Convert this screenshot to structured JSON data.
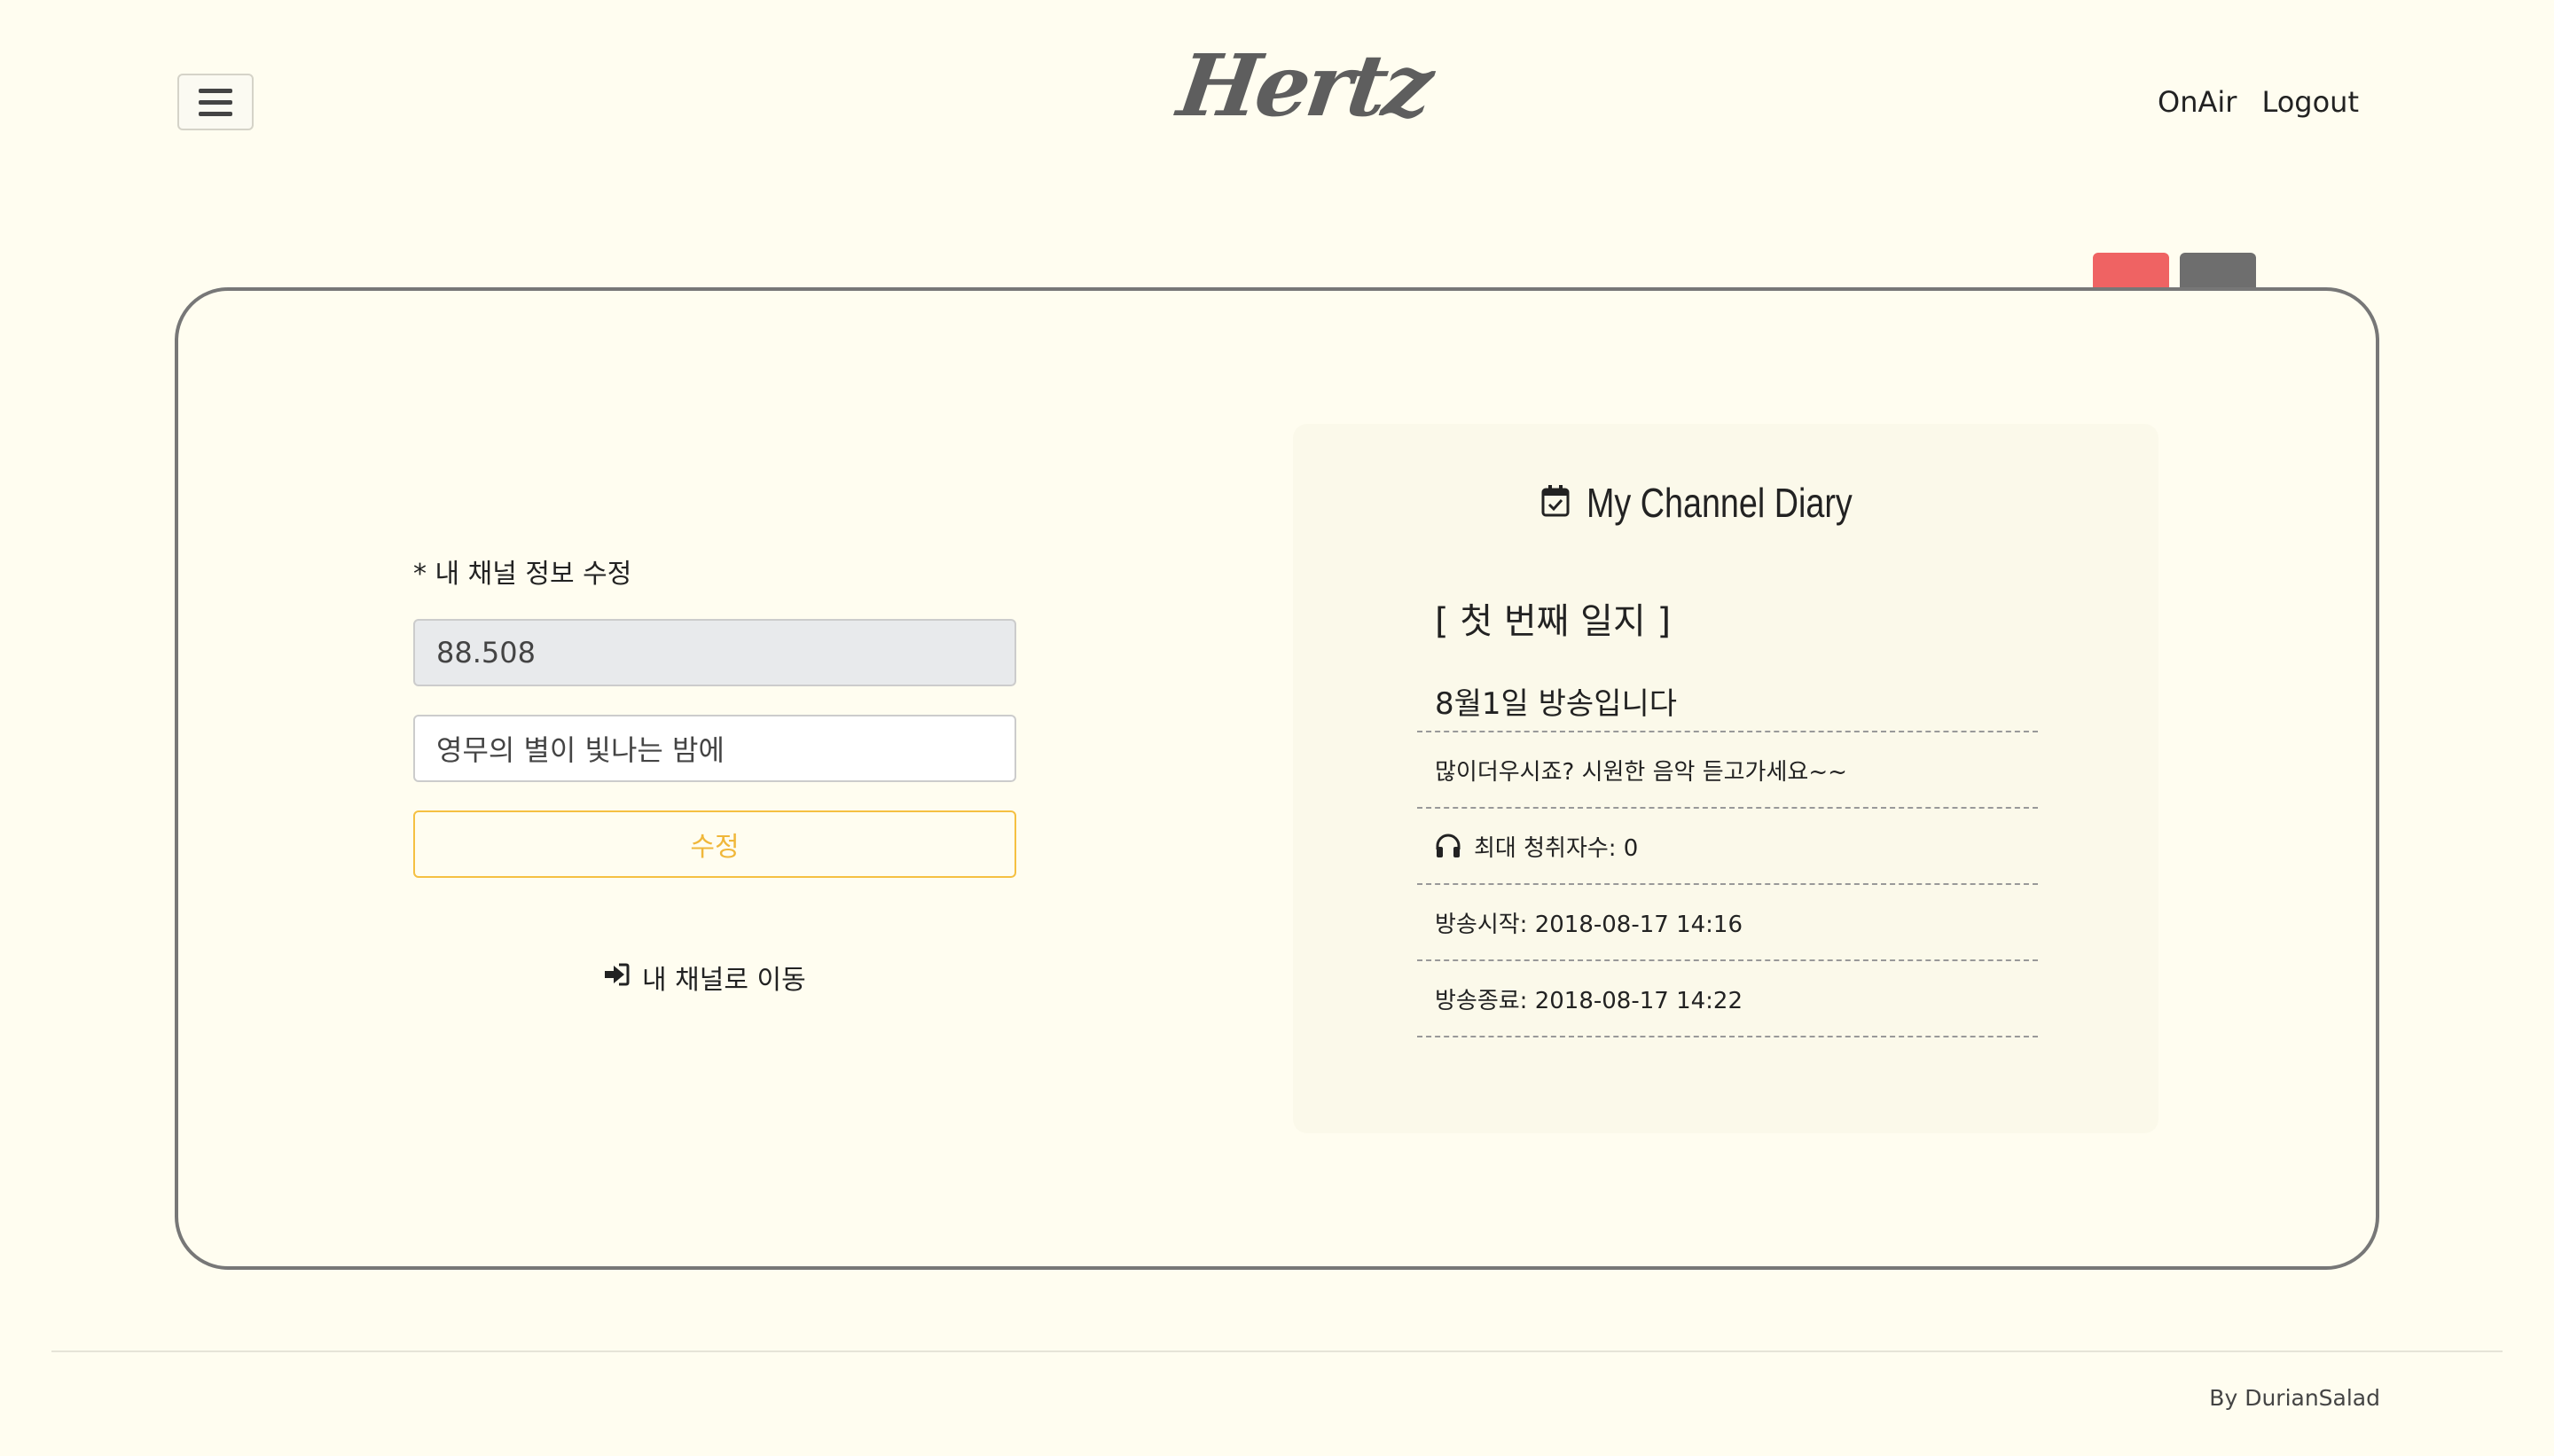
{
  "header": {
    "logo": "Hertz",
    "nav": [
      "OnAir",
      "Logout"
    ]
  },
  "form": {
    "title": "* 내 채널 정보 수정",
    "frequency_value": "88.508",
    "channel_name_value": "영무의 별이 빛나는 밤에",
    "submit_label": "수정",
    "go_channel_label": "내 채널로 이동"
  },
  "diary": {
    "title": "My Channel Diary",
    "heading": "[ 첫 번째 일지 ]",
    "subject": "8월1일 방송입니다",
    "message": "많이더우시죠? 시원한 음악 듣고가세요~~",
    "max_listeners": "최대 청취자수: 0",
    "start_time": "방송시작: 2018-08-17 14:16",
    "end_time": "방송종료: 2018-08-17 14:22"
  },
  "footer": {
    "credit": "By DurianSalad"
  },
  "colors": {
    "background": "#fffdf0",
    "tab_red": "#ef6363",
    "tab_gray": "#6e6e6e",
    "accent_yellow": "#f0b73a"
  }
}
